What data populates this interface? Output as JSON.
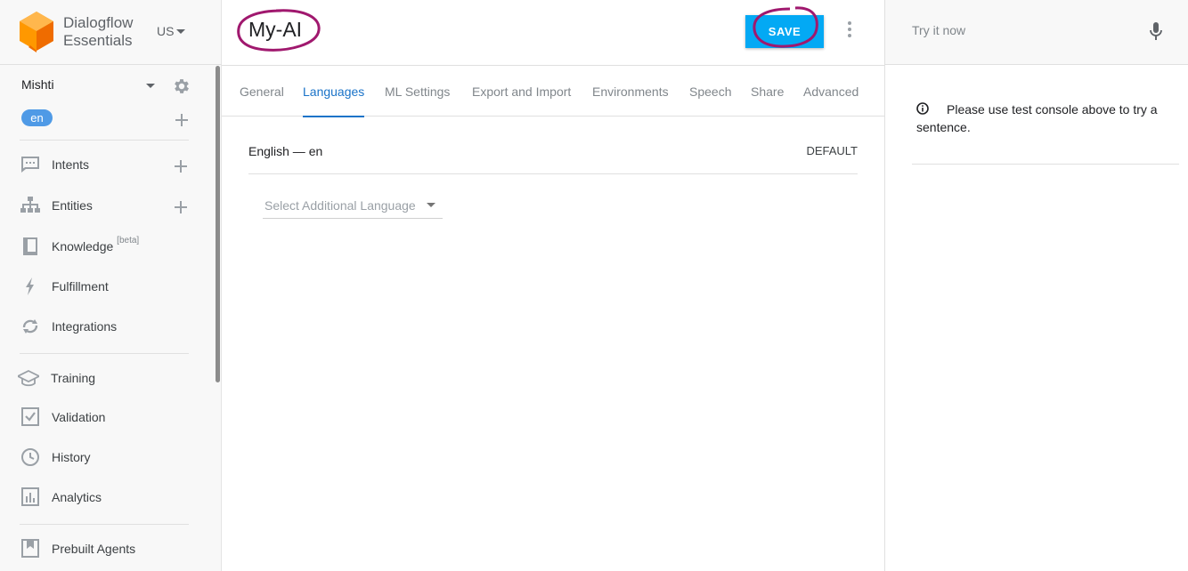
{
  "brand": {
    "line1": "Dialogflow",
    "line2": "Essentials",
    "region": "US",
    "color": "#ff8f00"
  },
  "agent": {
    "name": "Mishti",
    "language_chip": "en"
  },
  "nav": {
    "intents": "Intents",
    "entities": "Entities",
    "knowledge": "Knowledge",
    "knowledge_badge": "[beta]",
    "fulfillment": "Fulfillment",
    "integrations": "Integrations",
    "training": "Training",
    "validation": "Validation",
    "history": "History",
    "analytics": "Analytics",
    "prebuilt_agents": "Prebuilt Agents"
  },
  "header": {
    "title": "My-AI",
    "save_label": "SAVE",
    "accent": "#03a9f4",
    "annotation_color": "#a0186e"
  },
  "tabs": [
    {
      "label": "General",
      "active": false
    },
    {
      "label": "Languages",
      "active": true
    },
    {
      "label": "ML Settings",
      "active": false
    },
    {
      "label": "Export and Import",
      "active": false
    },
    {
      "label": "Environments",
      "active": false
    },
    {
      "label": "Speech",
      "active": false
    },
    {
      "label": "Share",
      "active": false
    },
    {
      "label": "Advanced",
      "active": false
    }
  ],
  "languages": {
    "primary": "English — en",
    "primary_tag": "DEFAULT",
    "select_placeholder": "Select Additional Language"
  },
  "console": {
    "placeholder": "Try it now",
    "message": "Please use test console above to try a sentence."
  }
}
